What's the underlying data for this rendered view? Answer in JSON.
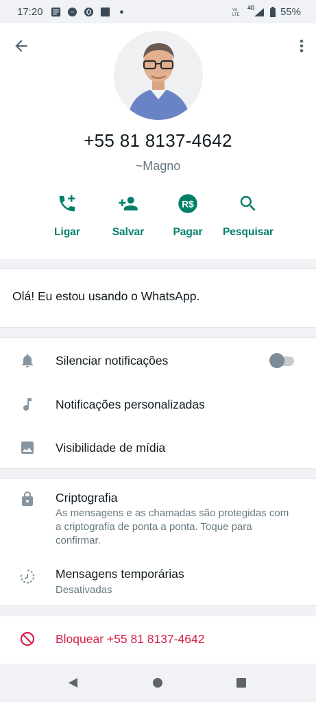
{
  "status_bar": {
    "time": "17:20",
    "battery": "55%",
    "network": "4G",
    "icons": [
      "news-icon",
      "messenger-icon",
      "shazam-icon",
      "square-app-icon",
      "dot-icon",
      "volte-icon",
      "signal-icon",
      "battery-icon"
    ]
  },
  "contact": {
    "phone": "+55 81 8137-4642",
    "push_name": "~Magno",
    "avatar": "contact-photo"
  },
  "actions": [
    {
      "label": "Ligar",
      "icon": "add-call-icon"
    },
    {
      "label": "Salvar",
      "icon": "add-contact-icon"
    },
    {
      "label": "Pagar",
      "icon": "payment-rs-icon"
    },
    {
      "label": "Pesquisar",
      "icon": "search-icon"
    }
  ],
  "about": {
    "text": "Olá! Eu estou usando o WhatsApp."
  },
  "settings": {
    "mute": {
      "label": "Silenciar notificações",
      "icon": "bell-icon",
      "enabled": false
    },
    "custom_notifications": {
      "label": "Notificações personalizadas",
      "icon": "music-note-icon"
    },
    "media_visibility": {
      "label": "Visibilidade de mídia",
      "icon": "image-icon"
    }
  },
  "security": {
    "encryption": {
      "label": "Criptografia",
      "sub": "As mensagens e as chamadas são protegidas com a criptografia de ponta a ponta. Toque para confirmar.",
      "icon": "lock-icon"
    },
    "disappearing": {
      "label": "Mensagens temporárias",
      "sub": "Desativadas",
      "icon": "timer-icon"
    }
  },
  "block": {
    "label": "Bloquear +55 81 8137-4642",
    "icon": "block-icon"
  },
  "colors": {
    "accent": "#008069",
    "danger": "#d6224a",
    "icon_gray": "#8696a0",
    "text_secondary": "#667781"
  },
  "nav": {
    "buttons": [
      "back-triangle-icon",
      "home-circle-icon",
      "recents-square-icon"
    ]
  }
}
